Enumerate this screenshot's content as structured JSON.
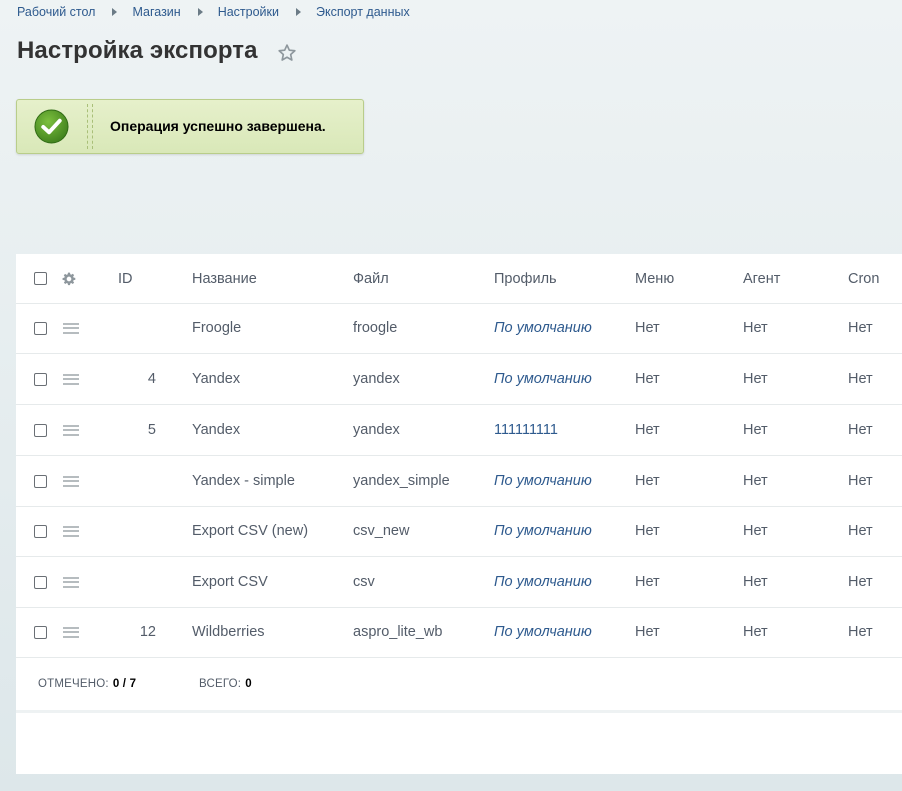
{
  "breadcrumb": [
    "Рабочий стол",
    "Магазин",
    "Настройки",
    "Экспорт данных"
  ],
  "page": {
    "title": "Настройка экспорта"
  },
  "alert": {
    "message": "Операция успешно завершена.",
    "status_color": "#4a8f23"
  },
  "grid": {
    "columns": {
      "id": "ID",
      "name": "Название",
      "file": "Файл",
      "profile": "Профиль",
      "menu": "Меню",
      "agent": "Агент",
      "cron": "Cron"
    },
    "rows": [
      {
        "id": "",
        "name": "Froogle",
        "file": "froogle",
        "profile": "По умолчанию",
        "menu": "Нет",
        "agent": "Нет",
        "cron": "Нет"
      },
      {
        "id": "4",
        "name": "Yandex",
        "file": "yandex",
        "profile": "По умолчанию",
        "menu": "Нет",
        "agent": "Нет",
        "cron": "Нет"
      },
      {
        "id": "5",
        "name": "Yandex",
        "file": "yandex",
        "profile": "111111111",
        "menu": "Нет",
        "agent": "Нет",
        "cron": "Нет"
      },
      {
        "id": "",
        "name": "Yandex - simple",
        "file": "yandex_simple",
        "profile": "По умолчанию",
        "menu": "Нет",
        "agent": "Нет",
        "cron": "Нет"
      },
      {
        "id": "",
        "name": "Export CSV (new)",
        "file": "csv_new",
        "profile": "По умолчанию",
        "menu": "Нет",
        "agent": "Нет",
        "cron": "Нет"
      },
      {
        "id": "",
        "name": "Export CSV",
        "file": "csv",
        "profile": "По умолчанию",
        "menu": "Нет",
        "agent": "Нет",
        "cron": "Нет"
      },
      {
        "id": "12",
        "name": "Wildberries",
        "file": "aspro_lite_wb",
        "profile": "По умолчанию",
        "menu": "Нет",
        "agent": "Нет",
        "cron": "Нет"
      }
    ]
  },
  "footer": {
    "checked_label": "ОТМЕЧЕНО:",
    "checked_value": "0 / 7",
    "total_label": "ВСЕГО:",
    "total_value": "0"
  },
  "colors": {
    "link": "#2e5a8e",
    "accent": "#4a8f23"
  }
}
